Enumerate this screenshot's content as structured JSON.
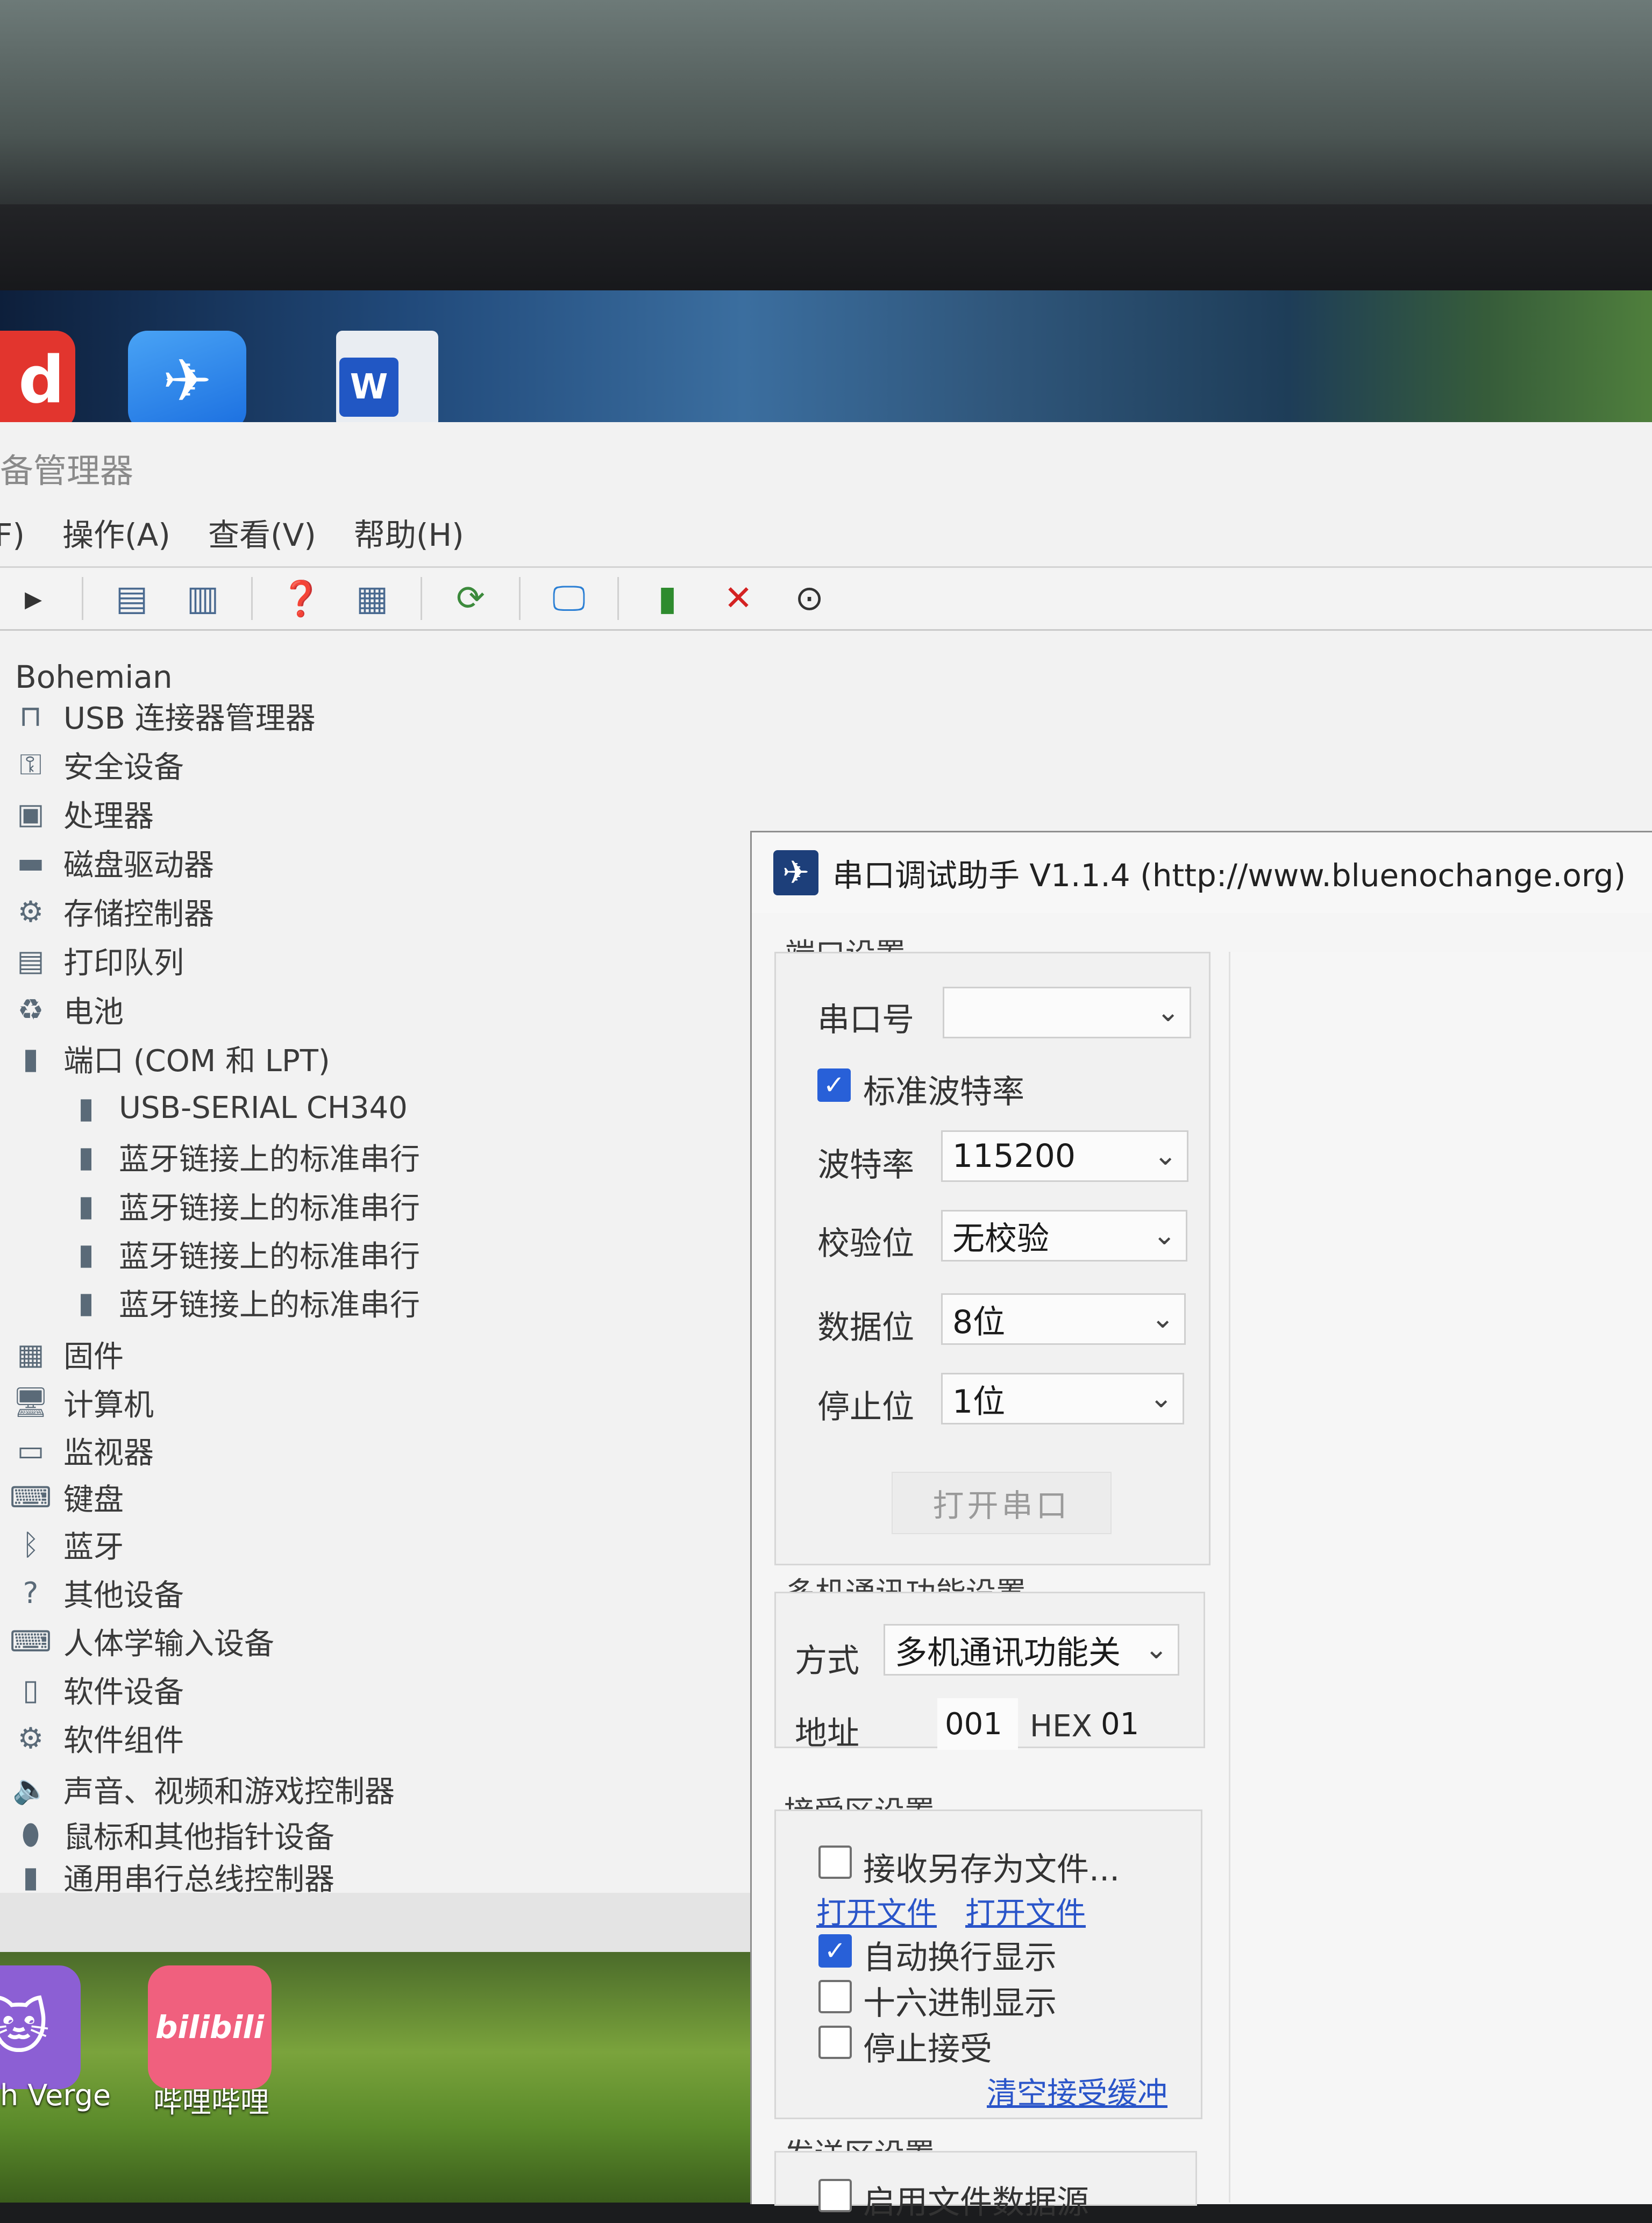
{
  "desktop_top": {
    "icons": [
      {
        "name": "red-app",
        "glyph": "d"
      },
      {
        "name": "blue-bird-app",
        "glyph": "✈"
      },
      {
        "name": "word-doc",
        "glyph": "W"
      }
    ]
  },
  "device_manager": {
    "title": "备管理器",
    "menu": [
      "F)",
      "操作(A)",
      "查看(V)",
      "帮助(H)"
    ],
    "toolbar_icons": [
      "back-icon",
      "properties-icon",
      "document-icon",
      "help-icon",
      "view-icon",
      "scan-icon",
      "monitor-icon",
      "update-driver-icon",
      "uninstall-icon",
      "download-icon"
    ],
    "tree_root": "Bohemian",
    "tree": [
      {
        "label": "USB 连接器管理器",
        "icon": "usb-icon",
        "glyph": "⊓"
      },
      {
        "label": "安全设备",
        "icon": "security-device-icon",
        "glyph": "⚿"
      },
      {
        "label": "处理器",
        "icon": "processor-icon",
        "glyph": "▣"
      },
      {
        "label": "磁盘驱动器",
        "icon": "disk-icon",
        "glyph": "▬"
      },
      {
        "label": "存储控制器",
        "icon": "storage-icon",
        "glyph": "⚙"
      },
      {
        "label": "打印队列",
        "icon": "printer-icon",
        "glyph": "▤"
      },
      {
        "label": "电池",
        "icon": "battery-icon",
        "glyph": "♻"
      },
      {
        "label": "端口 (COM 和 LPT)",
        "icon": "port-icon",
        "glyph": "▮"
      },
      {
        "label": "USB-SERIAL CH340",
        "icon": "port-device-icon",
        "glyph": "▮",
        "child": true
      },
      {
        "label": "蓝牙链接上的标准串行",
        "icon": "port-device-icon",
        "glyph": "▮",
        "child": true
      },
      {
        "label": "蓝牙链接上的标准串行",
        "icon": "port-device-icon",
        "glyph": "▮",
        "child": true
      },
      {
        "label": "蓝牙链接上的标准串行",
        "icon": "port-device-icon",
        "glyph": "▮",
        "child": true
      },
      {
        "label": "蓝牙链接上的标准串行",
        "icon": "port-device-icon",
        "glyph": "▮",
        "child": true
      },
      {
        "label": "固件",
        "icon": "firmware-icon",
        "glyph": "▦"
      },
      {
        "label": "计算机",
        "icon": "computer-icon",
        "glyph": "🖥"
      },
      {
        "label": "监视器",
        "icon": "monitor-icon",
        "glyph": "▭"
      },
      {
        "label": "键盘",
        "icon": "keyboard-icon",
        "glyph": "⌨"
      },
      {
        "label": "蓝牙",
        "icon": "bluetooth-icon",
        "glyph": "ᛒ"
      },
      {
        "label": "其他设备",
        "icon": "other-devices-icon",
        "glyph": "?"
      },
      {
        "label": "人体学输入设备",
        "icon": "hid-icon",
        "glyph": "⌨"
      },
      {
        "label": "软件设备",
        "icon": "software-device-icon",
        "glyph": "▯"
      },
      {
        "label": "软件组件",
        "icon": "software-component-icon",
        "glyph": "⚙"
      },
      {
        "label": "声音、视频和游戏控制器",
        "icon": "sound-icon",
        "glyph": "🔈"
      },
      {
        "label": "鼠标和其他指针设备",
        "icon": "mouse-icon",
        "glyph": "⬮"
      },
      {
        "label": "通用串行总线控制器",
        "icon": "usb-controller-icon",
        "glyph": "▮"
      }
    ]
  },
  "desktop_bottom": {
    "icons": [
      {
        "name": "verge-app",
        "glyph": "🐱",
        "label": "h Verge"
      },
      {
        "name": "bilibili-app",
        "glyph": "bilibili",
        "label": "哔哩哔哩"
      }
    ]
  },
  "serial_tool": {
    "title": "串口调试助手 V1.1.4 (http://www.bluenochange.org)",
    "port_group_label": "端口设置",
    "port_label": "串口号",
    "port_value": "",
    "std_baud_label": "标准波特率",
    "std_baud_checked": true,
    "baud_label": "波特率",
    "baud_value": "115200",
    "parity_label": "校验位",
    "parity_value": "无校验",
    "data_bits_label": "数据位",
    "data_bits_value": "8位",
    "stop_bits_label": "停止位",
    "stop_bits_value": "1位",
    "open_button": "打开串口",
    "multi_group_label": "多机通讯功能设置",
    "mode_label": "方式",
    "mode_value": "多机通讯功能关",
    "address_label": "地址",
    "address_value": "001",
    "hex_label": "HEX",
    "hex_value": "01",
    "recv_group_label": "接受区设置",
    "save_to_file_label": "接收另存为文件...",
    "save_to_file_checked": false,
    "open_file_link_1": "打开文件",
    "open_file_link_2": "打开文件",
    "auto_wrap_label": "自动换行显示",
    "auto_wrap_checked": true,
    "hex_display_label": "十六进制显示",
    "hex_display_checked": false,
    "stop_recv_label": "停止接受",
    "stop_recv_checked": false,
    "clear_recv_link": "清空接受缓冲",
    "send_group_label": "发送区设置",
    "use_file_source_label": "启用文件数据源"
  }
}
